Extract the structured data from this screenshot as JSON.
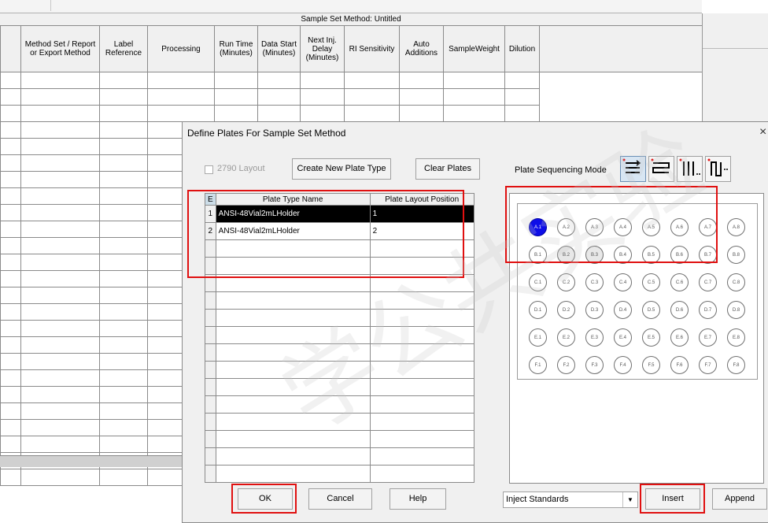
{
  "background": {
    "title": "Sample Set Method: Untitled",
    "columns": [
      "Method Set / Report or Export Method",
      "Label Reference",
      "Processing",
      "Run Time (Minutes)",
      "Data Start (Minutes)",
      "Next Inj. Delay (Minutes)",
      "RI Sensitivity",
      "Auto Additions",
      "SampleWeight",
      "Dilution"
    ],
    "row_count": 25
  },
  "dialog": {
    "title": "Define Plates For Sample Set Method",
    "close_glyph": "×",
    "layout_2790_label": "2790 Layout",
    "create_new_plate_type": "Create New Plate Type",
    "clear_plates": "Clear Plates",
    "plate_sequencing_mode_label": "Plate Sequencing Mode",
    "table": {
      "corner": "E",
      "headers": [
        "Plate Type Name",
        "Plate Layout Position"
      ],
      "rows": [
        {
          "num": "1",
          "name": "ANSI-48Vial2mLHolder",
          "position": "1",
          "selected": true
        },
        {
          "num": "2",
          "name": "ANSI-48Vial2mLHolder",
          "position": "2",
          "selected": false
        }
      ]
    },
    "vials": {
      "rows": [
        "A",
        "B",
        "C",
        "D",
        "E",
        "F"
      ],
      "cols": [
        "1",
        "2",
        "3",
        "4",
        "5",
        "6",
        "7",
        "8"
      ],
      "active": "A,1"
    },
    "buttons": {
      "ok": "OK",
      "cancel": "Cancel",
      "help": "Help",
      "insert": "Insert",
      "append": "Append"
    },
    "inject_select_value": "Inject Standards"
  },
  "watermark_text": "学公共实验"
}
